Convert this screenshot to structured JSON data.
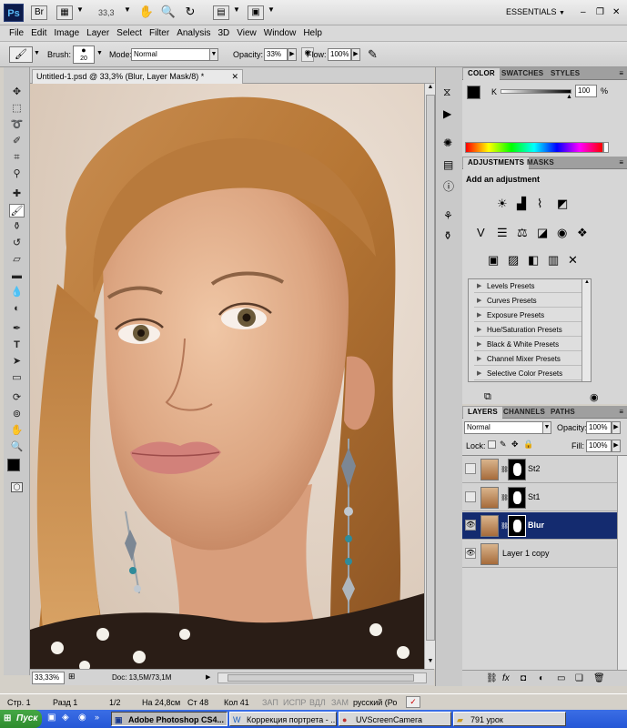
{
  "app_bar": {
    "logo": "Ps",
    "zoom": "33,3",
    "workspace": "ESSENTIALS",
    "icons": [
      "bridge-icon",
      "view-extras-icon",
      "hand-icon",
      "zoom-icon",
      "rotate-view-icon",
      "arrange-documents-icon",
      "screen-mode-icon"
    ]
  },
  "menu": [
    "File",
    "Edit",
    "Image",
    "Layer",
    "Select",
    "Filter",
    "Analysis",
    "3D",
    "View",
    "Window",
    "Help"
  ],
  "options": {
    "brush_label": "Brush:",
    "brush_size": "20",
    "mode_label": "Mode:",
    "mode_value": "Normal",
    "opacity_label": "Opacity:",
    "opacity_value": "33%",
    "flow_label": "Flow:",
    "flow_value": "100%"
  },
  "document": {
    "tab_title": "Untitled-1.psd @ 33,3% (Blur, Layer Mask/8) *",
    "zoom": "33,33%",
    "doc_size": "Doc: 13,5M/73,1M"
  },
  "color_panel": {
    "tabs": [
      "COLOR",
      "SWATCHES",
      "STYLES"
    ],
    "channel_label": "K",
    "channel_value": "100",
    "unit": "%"
  },
  "adjustments_panel": {
    "tabs": [
      "ADJUSTMENTS",
      "MASKS"
    ],
    "heading": "Add an adjustment",
    "presets": [
      "Levels Presets",
      "Curves Presets",
      "Exposure Presets",
      "Hue/Saturation Presets",
      "Black & White Presets",
      "Channel Mixer Presets",
      "Selective Color Presets"
    ]
  },
  "layers_panel": {
    "tabs": [
      "LAYERS",
      "CHANNELS",
      "PATHS"
    ],
    "blend_mode": "Normal",
    "opacity_label": "Opacity:",
    "opacity_value": "100%",
    "lock_label": "Lock:",
    "fill_label": "Fill:",
    "fill_value": "100%",
    "layers": [
      {
        "name": "St2",
        "visible": false,
        "selected": false
      },
      {
        "name": "St1",
        "visible": false,
        "selected": false
      },
      {
        "name": "Blur",
        "visible": true,
        "selected": true
      },
      {
        "name": "Layer 1 copy",
        "visible": true,
        "selected": false
      }
    ]
  },
  "status_bar": {
    "page": "Стр. 1",
    "section": "Разд 1",
    "pages": "1/2",
    "position": "На 24,8см",
    "line": "Ст 48",
    "column": "Кол 41",
    "rec": "ЗАП",
    "trk": "ИСПР",
    "ext": "ВДЛ",
    "ovr": "ЗАМ",
    "language": "русский (Ро"
  },
  "taskbar": {
    "start": "Пуск",
    "buttons": [
      "Adobe Photoshop CS4...",
      "Коррекция портрета - ...",
      "UVScreenCamera",
      "791 урок"
    ]
  },
  "colors": {
    "selected_layer": "#142b6f",
    "panel_bg": "#d6d6d6",
    "app_bg": "#d4d0c8",
    "taskbar": "#2557d6"
  }
}
